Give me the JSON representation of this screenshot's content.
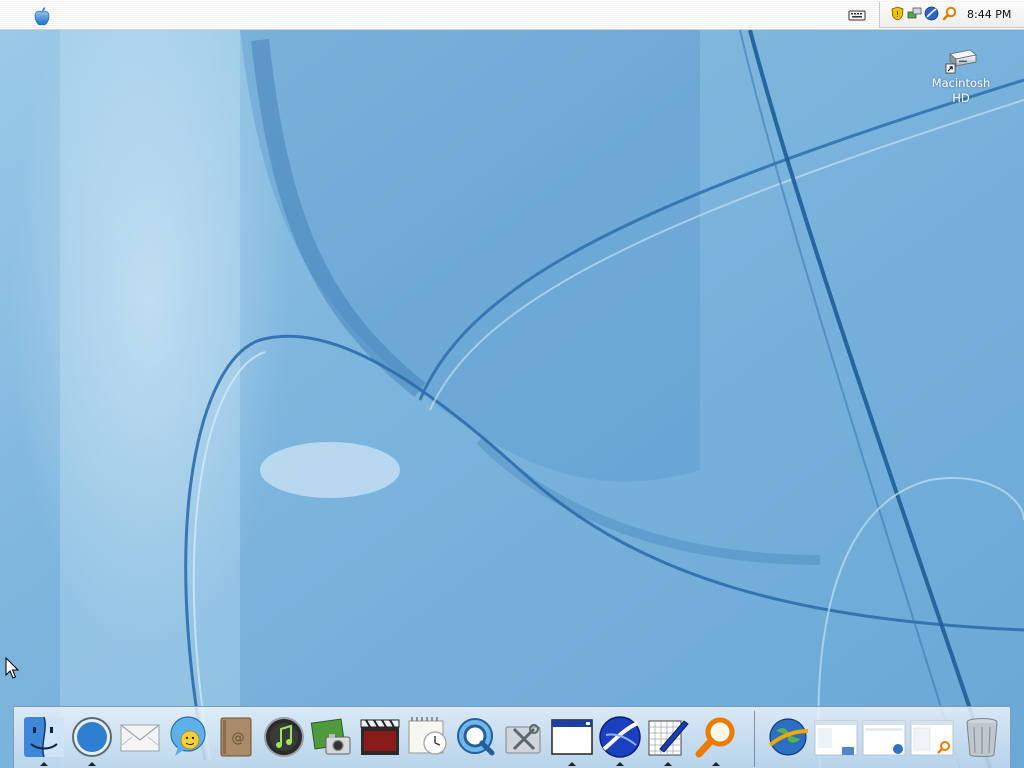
{
  "menubar": {
    "apple_menu_icon": "apple-logo-icon",
    "clock": "8:44 PM",
    "status_icons": [
      "keyboard-icon",
      "security-shield-icon",
      "network-icon",
      "browser-icon",
      "search-icon"
    ]
  },
  "desktop": {
    "icons": [
      {
        "label": "Macintosh\nHD",
        "icon": "hard-drive-icon"
      }
    ]
  },
  "dock": {
    "apps": [
      {
        "name": "finder",
        "icon": "finder-icon",
        "running": true
      },
      {
        "name": "browser",
        "icon": "compass-icon",
        "running": true
      },
      {
        "name": "mail",
        "icon": "mail-icon",
        "running": false
      },
      {
        "name": "messenger",
        "icon": "chat-icon",
        "running": false
      },
      {
        "name": "address-book",
        "icon": "address-book-icon",
        "running": false
      },
      {
        "name": "music",
        "icon": "music-icon",
        "running": false
      },
      {
        "name": "photos",
        "icon": "camera-icon",
        "running": false
      },
      {
        "name": "movies",
        "icon": "film-icon",
        "running": false
      },
      {
        "name": "calendar",
        "icon": "calendar-clock-icon",
        "running": false
      },
      {
        "name": "quicktime",
        "icon": "quicktime-icon",
        "running": false
      },
      {
        "name": "utilities",
        "icon": "tools-icon",
        "running": false
      },
      {
        "name": "window",
        "icon": "window-icon",
        "running": true
      },
      {
        "name": "web-browser",
        "icon": "blue-globe-icon",
        "running": true
      },
      {
        "name": "editor",
        "icon": "pen-grid-icon",
        "running": true
      },
      {
        "name": "search",
        "icon": "magnifier-icon",
        "running": true
      }
    ],
    "right_items": [
      {
        "name": "internet",
        "icon": "globe-icon"
      },
      {
        "name": "minimized-window-1",
        "icon": "window-thumbnail-icon"
      },
      {
        "name": "minimized-window-2",
        "icon": "window-thumbnail-icon"
      },
      {
        "name": "minimized-window-3",
        "icon": "window-thumbnail-icon"
      },
      {
        "name": "trash",
        "icon": "trash-icon"
      }
    ]
  },
  "colors": {
    "wallpaper_base": "#7fb6dc",
    "wallpaper_dark": "#3d7fb8",
    "menubar": "#f4f4f4"
  }
}
